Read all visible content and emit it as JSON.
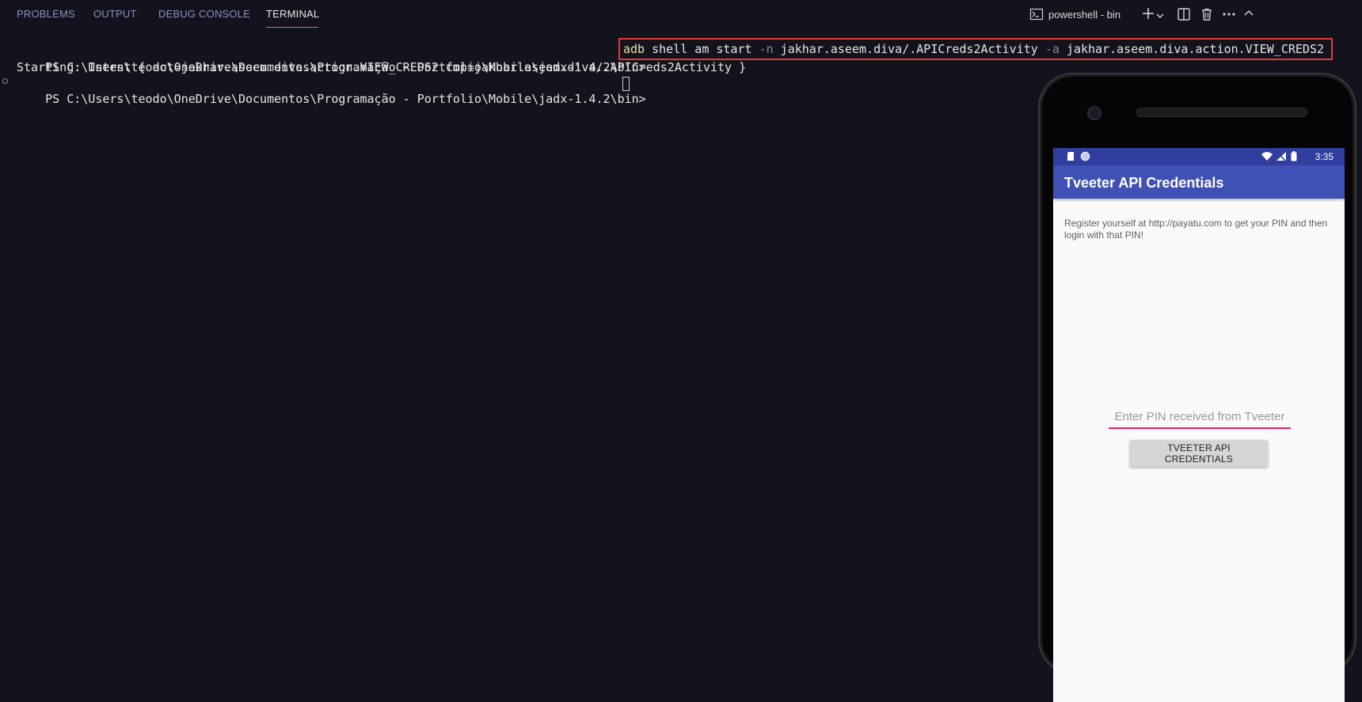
{
  "panel": {
    "tabs": [
      "PROBLEMS",
      "OUTPUT",
      "DEBUG CONSOLE",
      "TERMINAL"
    ],
    "active_tab": "TERMINAL",
    "terminal_name": "powershell - bin"
  },
  "terminal": {
    "prompt_1": "PS C:\\Users\\teodo\\OneDrive\\Documentos\\Programação - Portfolio\\Mobile\\jadx-1.4.2\\bin>",
    "command": {
      "adb": "adb",
      "part1": " shell am start ",
      "flag_n": "-n",
      "part2": " jakhar.aseem.diva/.APICreds2Activity ",
      "flag_a": "-a",
      "part3": " jakhar.aseem.diva.action.VIEW_CREDS2"
    },
    "output_line": "Starting: Intent { act=jakhar.aseem.diva.action.VIEW_CREDS2 cmp=jakhar.aseem.diva/.APICreds2Activity }",
    "prompt_2": "PS C:\\Users\\teodo\\OneDrive\\Documentos\\Programação - Portfolio\\Mobile\\jadx-1.4.2\\bin>"
  },
  "phone": {
    "status_time": "3:35",
    "app_title": "Tveeter API Credentials",
    "description": "Register yourself at http://payatu.com to get your PIN and then login with that PIN!",
    "pin_placeholder": "Enter PIN received from Tveeter",
    "button_label": "TVEETER API CREDENTIALS",
    "colors": {
      "status_bar": "#303f9f",
      "app_bar": "#3f51b5",
      "input_underline": "#e91e63"
    }
  },
  "colors": {
    "terminal_bg": "#13131d",
    "command_highlight_border": "#e53935",
    "active_tab_underline": "#e05a9b"
  }
}
